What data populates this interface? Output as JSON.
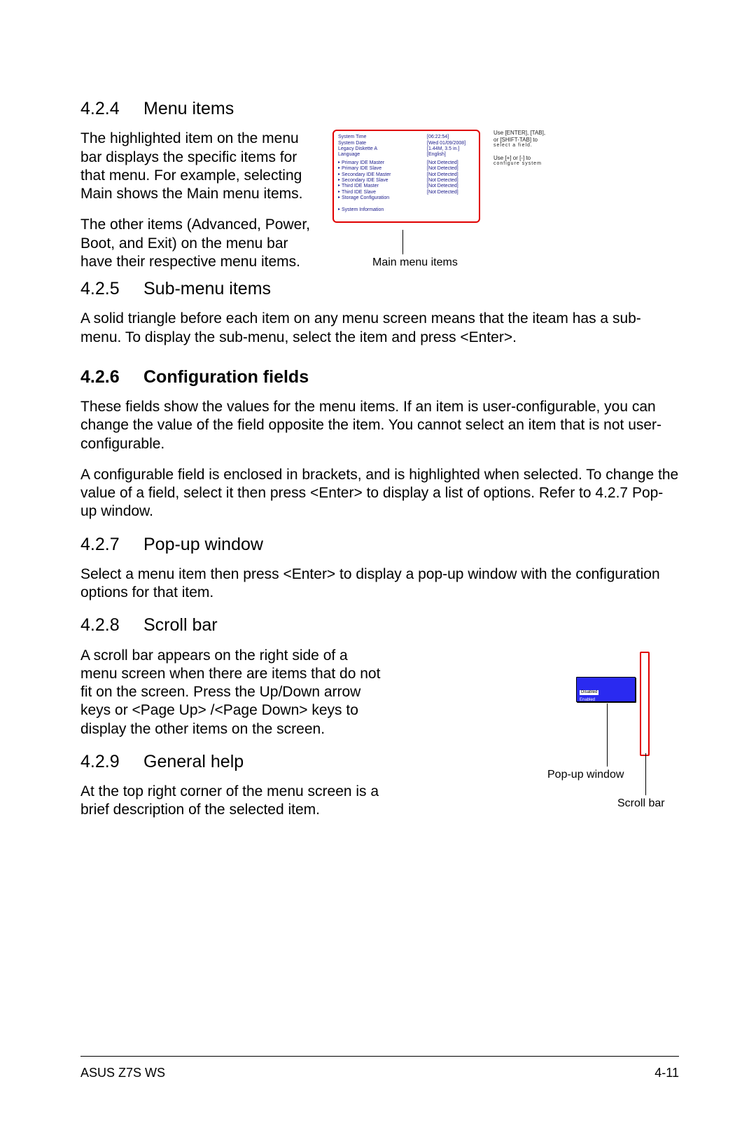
{
  "sections": {
    "s424": {
      "num": "4.2.4",
      "title": "Menu items",
      "p1": "The highlighted item on the menu bar displays the specific items for that menu. For example, selecting Main shows the Main menu items.",
      "p2": "The other items (Advanced, Power, Boot, and Exit) on the menu bar have their respective menu items."
    },
    "s425": {
      "num": "4.2.5",
      "title": "Sub-menu items",
      "p1": "A solid triangle before each item on any menu screen means that the iteam has a sub-menu. To display the sub-menu, select the item and press <Enter>."
    },
    "s426": {
      "num": "4.2.6",
      "title": "Configuration fields",
      "p1": "These fields show the values for the menu items. If an item is user-configurable, you can change the value of the field opposite the item. You cannot select an item that is not user-configurable.",
      "p2": "A configurable field is enclosed in brackets, and is highlighted when selected. To change the value of a field, select it then press <Enter> to display a list of options. Refer to  4.2.7 Pop-up window."
    },
    "s427": {
      "num": "4.2.7",
      "title": "Pop-up window",
      "p1": "Select a menu item then press <Enter> to display a pop-up window with the configuration options for that item."
    },
    "s428": {
      "num": "4.2.8",
      "title": "Scroll bar",
      "p1": "A scroll bar appears on the right side of a menu screen when there are items that do not fit on the screen. Press the Up/Down arrow keys or <Page Up> /<Page Down> keys to display the other items on the screen."
    },
    "s429": {
      "num": "4.2.9",
      "title": "General help",
      "p1": "At the top right corner of the menu screen is a brief description of the selected item."
    }
  },
  "fig1": {
    "rows": [
      {
        "k": "System Time",
        "v": "[06:22:54]"
      },
      {
        "k": "System Date",
        "v": "[Wed 01/09/2008]"
      },
      {
        "k": "Legacy Diskette A",
        "v": "[1.44M, 3.5 in.]"
      },
      {
        "k": "Language",
        "v": "[English]"
      }
    ],
    "subs": [
      {
        "k": "Primary IDE Master",
        "v": "[Not Detected]"
      },
      {
        "k": "Primary IDE Slave",
        "v": "[Not Detected]"
      },
      {
        "k": "Secondary IDE Master",
        "v": "[Not Detected]"
      },
      {
        "k": "Secondary IDE Slave",
        "v": "[Not Detected]"
      },
      {
        "k": "Third IDE Master",
        "v": "[Not Detected]"
      },
      {
        "k": "Third IDE Slave",
        "v": "[Not Detected]"
      }
    ],
    "storage": "Storage Configuration",
    "sysinfo": "System Information",
    "side_l1": "Use [ENTER], [TAB],",
    "side_l2": "or [SHIFT-TAB] to",
    "side_l3": "select a field.",
    "side_l4": "Use [+] or [-] to",
    "side_l5": "configure system",
    "caption": "Main menu items"
  },
  "fig2": {
    "opt1": "Disabled",
    "opt2": "Enabled",
    "cap_popup": "Pop-up window",
    "cap_scroll": "Scroll bar"
  },
  "footer": {
    "left": "ASUS Z7S WS",
    "right": "4-11"
  }
}
